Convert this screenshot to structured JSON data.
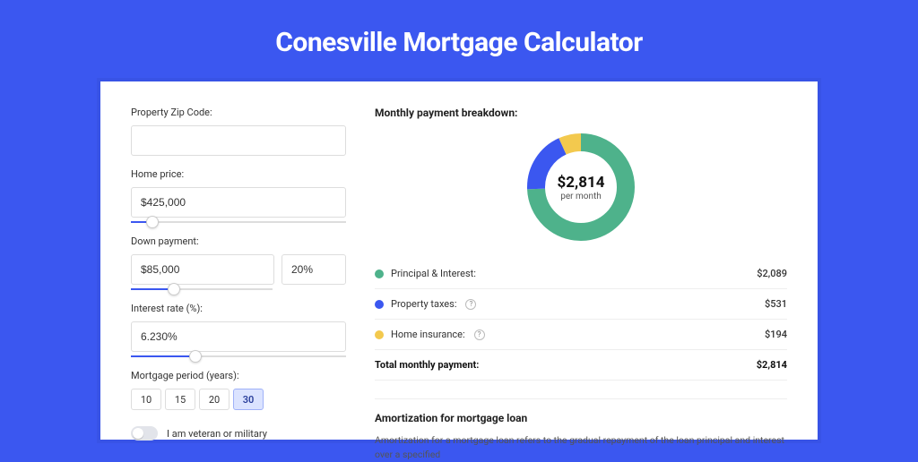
{
  "title": "Conesville Mortgage Calculator",
  "form": {
    "zip": {
      "label": "Property Zip Code:",
      "value": ""
    },
    "homePrice": {
      "label": "Home price:",
      "value": "$425,000",
      "sliderFill": 10
    },
    "downPayment": {
      "label": "Down payment:",
      "value": "$85,000",
      "pct": "20%",
      "sliderFill": 20
    },
    "interestRate": {
      "label": "Interest rate (%):",
      "value": "6.230%",
      "sliderFill": 30
    },
    "period": {
      "label": "Mortgage period (years):",
      "options": [
        "10",
        "15",
        "20",
        "30"
      ],
      "selected": "30"
    },
    "veteran": {
      "label": "I am veteran or military",
      "on": false
    }
  },
  "breakdown": {
    "title": "Monthly payment breakdown:",
    "donut": {
      "value": "$2,814",
      "sub": "per month"
    },
    "items": [
      {
        "label": "Principal & Interest:",
        "value": "$2,089",
        "color": "green",
        "info": false
      },
      {
        "label": "Property taxes:",
        "value": "$531",
        "color": "blue",
        "info": true
      },
      {
        "label": "Home insurance:",
        "value": "$194",
        "color": "yellow",
        "info": true
      }
    ],
    "total": {
      "label": "Total monthly payment:",
      "value": "$2,814"
    }
  },
  "amortization": {
    "title": "Amortization for mortgage loan",
    "text": "Amortization for a mortgage loan refers to the gradual repayment of the loan principal and interest over a specified"
  },
  "icons": {
    "info": "?"
  },
  "chart_data": {
    "type": "pie",
    "title": "Monthly payment breakdown",
    "series": [
      {
        "name": "Principal & Interest",
        "value": 2089,
        "color": "#4eb28b"
      },
      {
        "name": "Property taxes",
        "value": 531,
        "color": "#3b57f0"
      },
      {
        "name": "Home insurance",
        "value": 194,
        "color": "#f3c94e"
      }
    ],
    "total": 2814,
    "unit": "USD/month"
  }
}
